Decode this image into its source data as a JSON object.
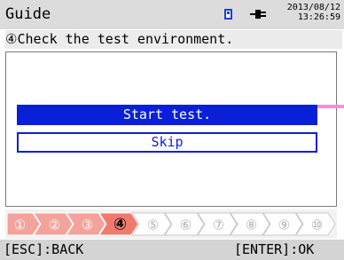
{
  "header": {
    "title": "Guide",
    "date": "2013/08/12",
    "time": "13:26:59",
    "storage_icon": "sd-card-icon",
    "power_icon": "ac-plug-icon"
  },
  "subtitle": "④Check the test environment.",
  "buttons": {
    "start": "Start test.",
    "skip": "Skip"
  },
  "steps": {
    "labels": [
      "①",
      "②",
      "③",
      "④",
      "⑤",
      "⑥",
      "⑦",
      "⑧",
      "⑨",
      "⑩"
    ],
    "current": 4,
    "done_color": "#f4a39c",
    "current_color": "#f07a6e",
    "pending_color": "#ffffff"
  },
  "footer": {
    "back": "[ESC]:BACK",
    "ok": "[ENTER]:OK"
  },
  "colors": {
    "accent": "#0a1fd8",
    "scroll_indicator": "#ff8ad8"
  }
}
